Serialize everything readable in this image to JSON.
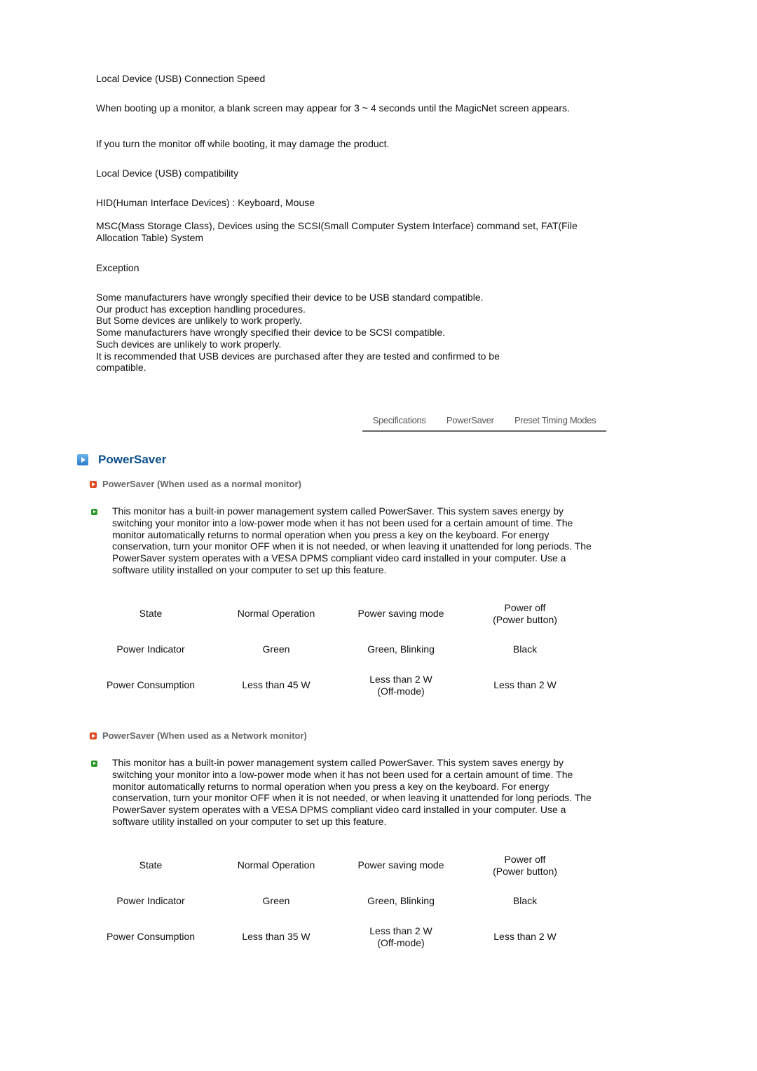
{
  "intro": {
    "connection_speed_title": "Local Device (USB) Connection Speed",
    "booting_note": "When booting up a monitor, a blank screen may appear for 3 ~ 4 seconds until the MagicNet screen appears.",
    "booting_warning": "If you turn the monitor off while booting, it may damage the product.",
    "compat_title": "Local Device (USB) compatibility",
    "hid": "HID(Human Interface Devices) : Keyboard, Mouse",
    "msc": "MSC(Mass Storage Class), Devices using the SCSI(Small Computer System Interface) command set, FAT(File Allocation Table) System",
    "exception_title": "Exception",
    "exception_lines": [
      "Some manufacturers have wrongly specified their device to be USB standard compatible.",
      "Our product has exception handling procedures.",
      "But Some devices are unlikely to work properly.",
      "Some manufacturers have wrongly specified their device to be SCSI compatible.",
      "Such devices are unlikely to work properly.",
      "It is recommended that USB devices are purchased after they are tested and confirmed to be compatible."
    ]
  },
  "tabs": [
    "Specifications",
    "PowerSaver",
    "Preset Timing Modes"
  ],
  "section_title": "PowerSaver",
  "subsections": [
    {
      "title": "PowerSaver (When used as a normal monitor)",
      "body": "This monitor has a built-in power management system called PowerSaver. This system saves energy by switching your monitor into a low-power mode when it has not been used for a certain amount of time. The monitor automatically returns to normal operation when you press a key on the keyboard. For energy conservation, turn your monitor OFF when it is not needed, or when leaving it unattended for long periods. The PowerSaver system operates with a VESA DPMS compliant video card installed in your computer. Use a software utility installed on your computer to set up this feature.",
      "table": [
        [
          "State",
          "Normal Operation",
          "Power saving mode",
          "Power off\n(Power button)"
        ],
        [
          "Power Indicator",
          "Green",
          "Green, Blinking",
          "Black"
        ],
        [
          "Power Consumption",
          "Less than 45 W",
          "Less than 2 W\n(Off-mode)",
          "Less than 2 W"
        ]
      ]
    },
    {
      "title": "PowerSaver (When used as a Network monitor)",
      "body": "This monitor has a built-in power management system called PowerSaver. This system saves energy by switching your monitor into a low-power mode when it has not been used for a certain amount of time. The monitor automatically returns to normal operation when you press a key on the keyboard. For energy conservation, turn your monitor OFF when it is not needed, or when leaving it unattended for long periods. The PowerSaver system operates with a VESA DPMS compliant video card installed in your computer. Use a software utility installed on your computer to set up this feature.",
      "table": [
        [
          "State",
          "Normal Operation",
          "Power saving mode",
          "Power off\n(Power button)"
        ],
        [
          "Power Indicator",
          "Green",
          "Green, Blinking",
          "Black"
        ],
        [
          "Power Consumption",
          "Less than 35 W",
          "Less than 2 W\n(Off-mode)",
          "Less than 2 W"
        ]
      ]
    }
  ]
}
